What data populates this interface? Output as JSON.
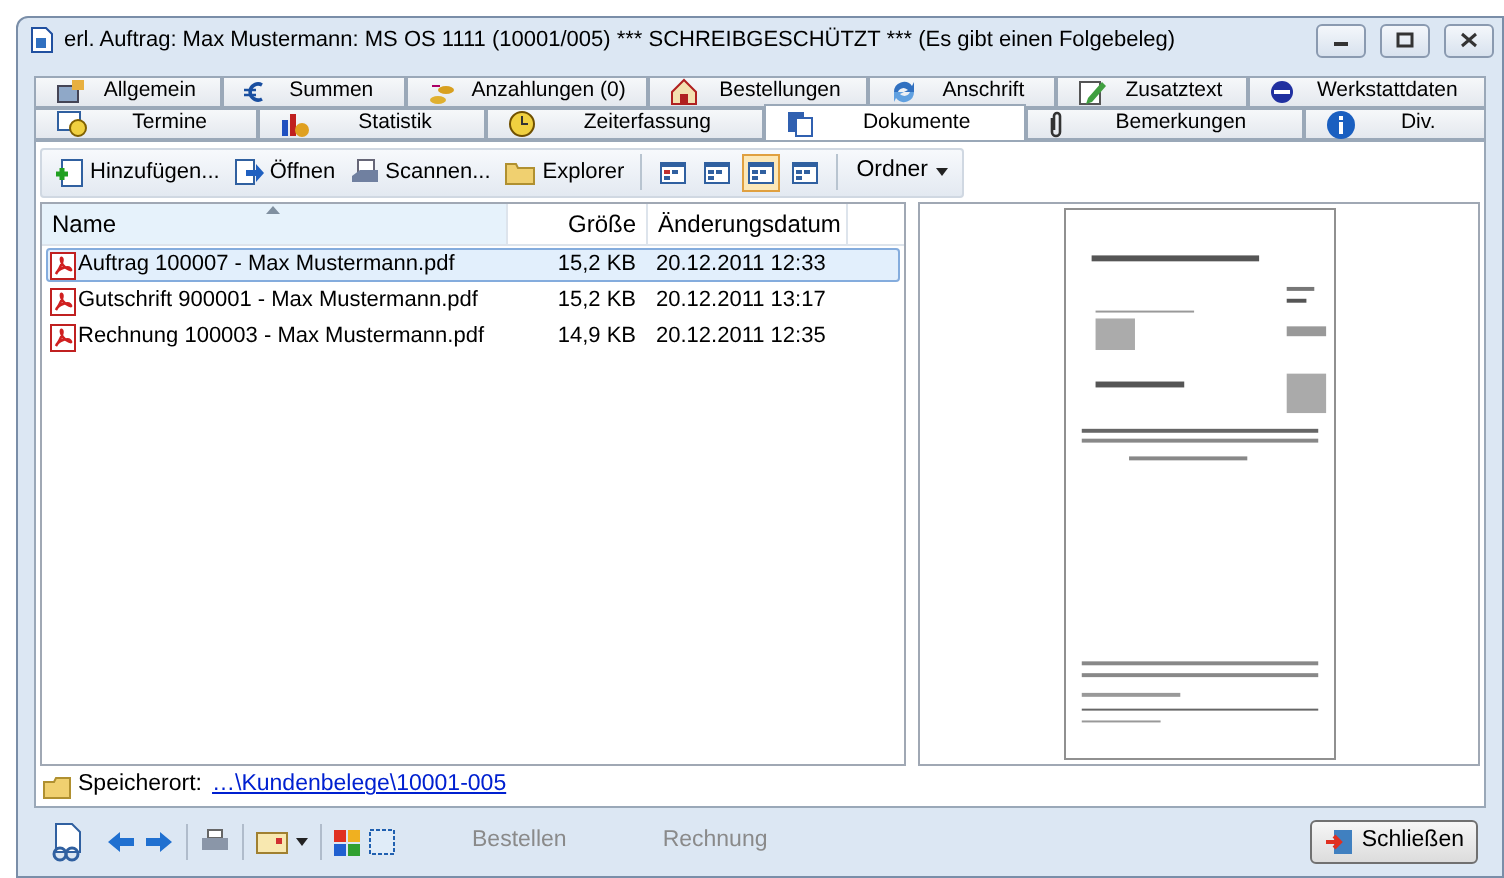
{
  "window": {
    "title": "erl. Auftrag:  Max Mustermann: MS OS 1111 (10001/005) *** SCHREIBGESCHÜTZT *** (Es gibt einen Folgebeleg)"
  },
  "tab_rows": [
    [
      {
        "label": "Allgemein",
        "selected": false
      },
      {
        "label": "Summen",
        "selected": false
      },
      {
        "label": "Anzahlungen (0)",
        "selected": false
      },
      {
        "label": "Bestellungen",
        "selected": false
      },
      {
        "label": "Anschrift",
        "selected": false
      },
      {
        "label": "Zusatztext",
        "selected": false
      },
      {
        "label": "Werkstattdaten",
        "selected": false
      }
    ],
    [
      {
        "label": "Termine",
        "selected": false
      },
      {
        "label": "Statistik",
        "selected": false
      },
      {
        "label": "Zeiterfassung",
        "selected": false
      },
      {
        "label": "Dokumente",
        "selected": true
      },
      {
        "label": "Bemerkungen",
        "selected": false
      },
      {
        "label": "Div.",
        "selected": false
      }
    ]
  ],
  "toolbar": {
    "actions": [
      "Hinzufügen...",
      "Öffnen",
      "Scannen...",
      "Explorer"
    ],
    "views": [
      {
        "selected": false
      },
      {
        "selected": false
      },
      {
        "selected": true
      },
      {
        "selected": false
      }
    ],
    "dropdown": "Ordner"
  },
  "file_list": {
    "columns": [
      "Name",
      "Größe",
      "Änderungsdatum"
    ],
    "rows": [
      {
        "name": "Auftrag 100007 - Max Mustermann.pdf",
        "size": "15,2 KB",
        "date": "20.12.2011 12:33",
        "selected": true
      },
      {
        "name": "Gutschrift 900001 - Max Mustermann.pdf",
        "size": "15,2 KB",
        "date": "20.12.2011 13:17",
        "selected": false
      },
      {
        "name": "Rechnung 100003 - Max Mustermann.pdf",
        "size": "14,9 KB",
        "date": "20.12.2011 12:35",
        "selected": false
      }
    ]
  },
  "storage": {
    "label": "Speicherort:",
    "path": "…\\Kundenbelege\\10001-005"
  },
  "bottom_bar": {
    "buttons": [
      {
        "label": "Bestellen",
        "disabled": true
      },
      {
        "label": "Rechnung",
        "disabled": true
      }
    ],
    "close": "Schließen"
  }
}
